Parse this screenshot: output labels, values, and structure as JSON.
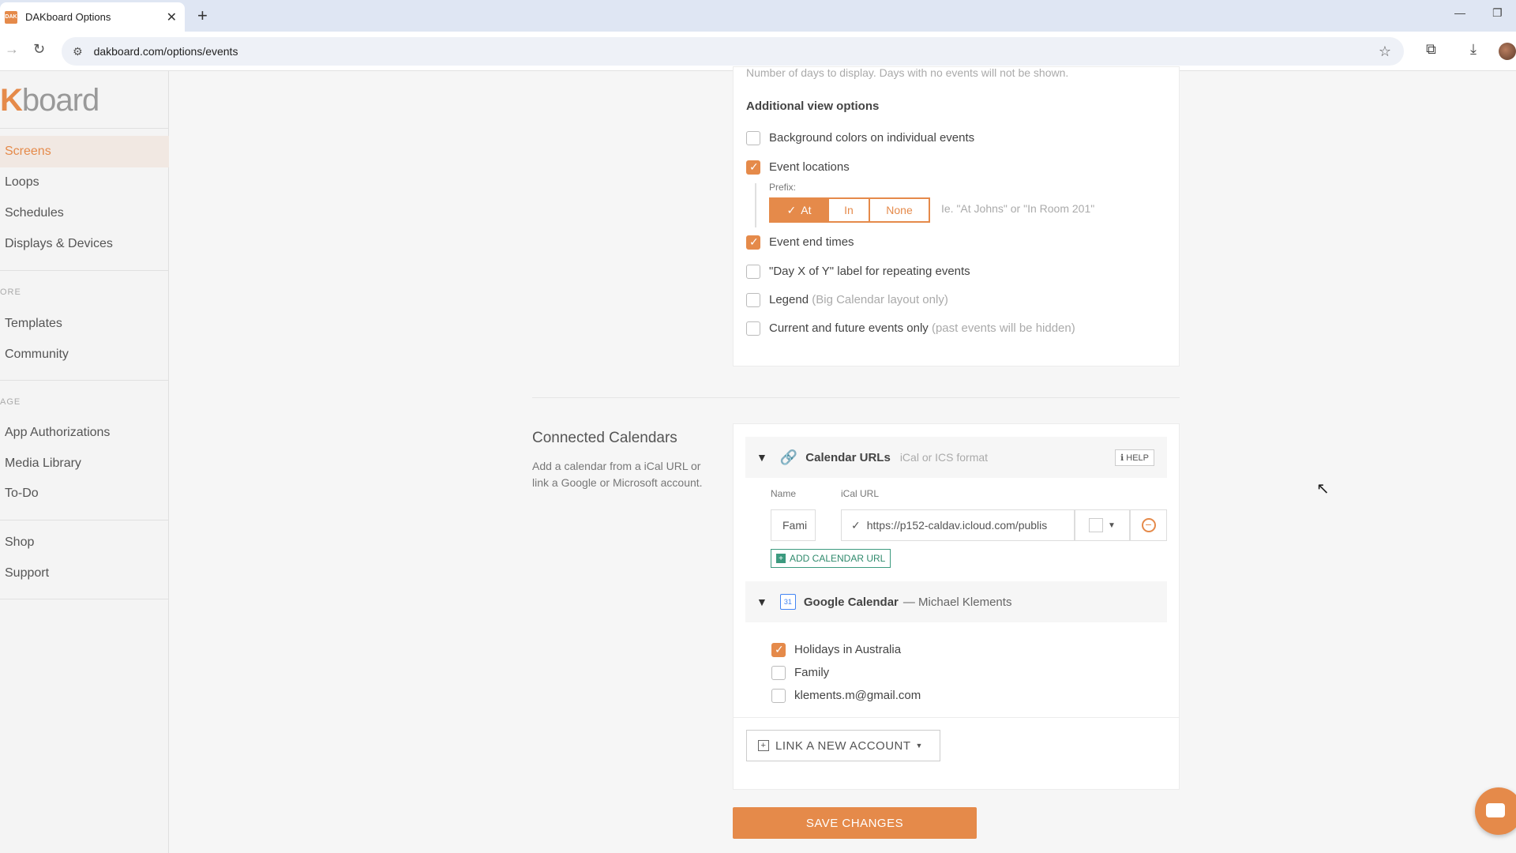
{
  "browser": {
    "tab_title": "DAKboard Options",
    "favicon_text": "DAK",
    "url": "dakboard.com/options/events"
  },
  "sidebar": {
    "logo_prefix": "K",
    "logo_suffix": "board",
    "items_group1": [
      "Screens",
      "Loops",
      "Schedules",
      "Displays & Devices"
    ],
    "heading2": "ORE",
    "items_group2": [
      "Templates",
      "Community"
    ],
    "heading3": "AGE",
    "items_group3": [
      "App Authorizations",
      "Media Library",
      "To-Do"
    ],
    "items_group4": [
      "Shop",
      "Support"
    ]
  },
  "view_options": {
    "top_hint": "Number of days to display. Days with no events will not be shown.",
    "heading": "Additional view options",
    "bg_colors": {
      "label": "Background colors on individual events",
      "checked": false
    },
    "locations": {
      "label": "Event locations",
      "checked": true
    },
    "prefix_label": "Prefix:",
    "prefix_options": [
      "At",
      "In",
      "None"
    ],
    "prefix_selected": "At",
    "prefix_hint": "Ie. \"At Johns\" or \"In Room 201\"",
    "end_times": {
      "label": "Event end times",
      "checked": true
    },
    "day_x_of_y": {
      "label": "\"Day X of Y\" label for repeating events",
      "checked": false
    },
    "legend": {
      "label": "Legend",
      "note": "(Big Calendar layout only)",
      "checked": false
    },
    "current_future": {
      "label": "Current and future events only",
      "note": "(past events will be hidden)",
      "checked": false
    }
  },
  "connected": {
    "title": "Connected Calendars",
    "description": "Add a calendar from a iCal URL or link a Google or Microsoft account.",
    "ical": {
      "title": "Calendar URLs",
      "subtitle": "iCal or ICS format",
      "help": "HELP",
      "col_name": "Name",
      "col_url": "iCal URL",
      "row_name": "Fami",
      "row_url": "https://p152-caldav.icloud.com/publis",
      "add_button": "ADD CALENDAR URL"
    },
    "google": {
      "title": "Google Calendar",
      "account": "— Michael Klements",
      "calendars": [
        {
          "label": "Holidays in Australia",
          "checked": true
        },
        {
          "label": "Family",
          "checked": false
        },
        {
          "label": "klements.m@gmail.com",
          "checked": false
        }
      ]
    },
    "link_account": "LINK A NEW ACCOUNT"
  },
  "save_button": "SAVE CHANGES",
  "colors": {
    "accent": "#e58a4a",
    "green": "#3c9a7f"
  }
}
